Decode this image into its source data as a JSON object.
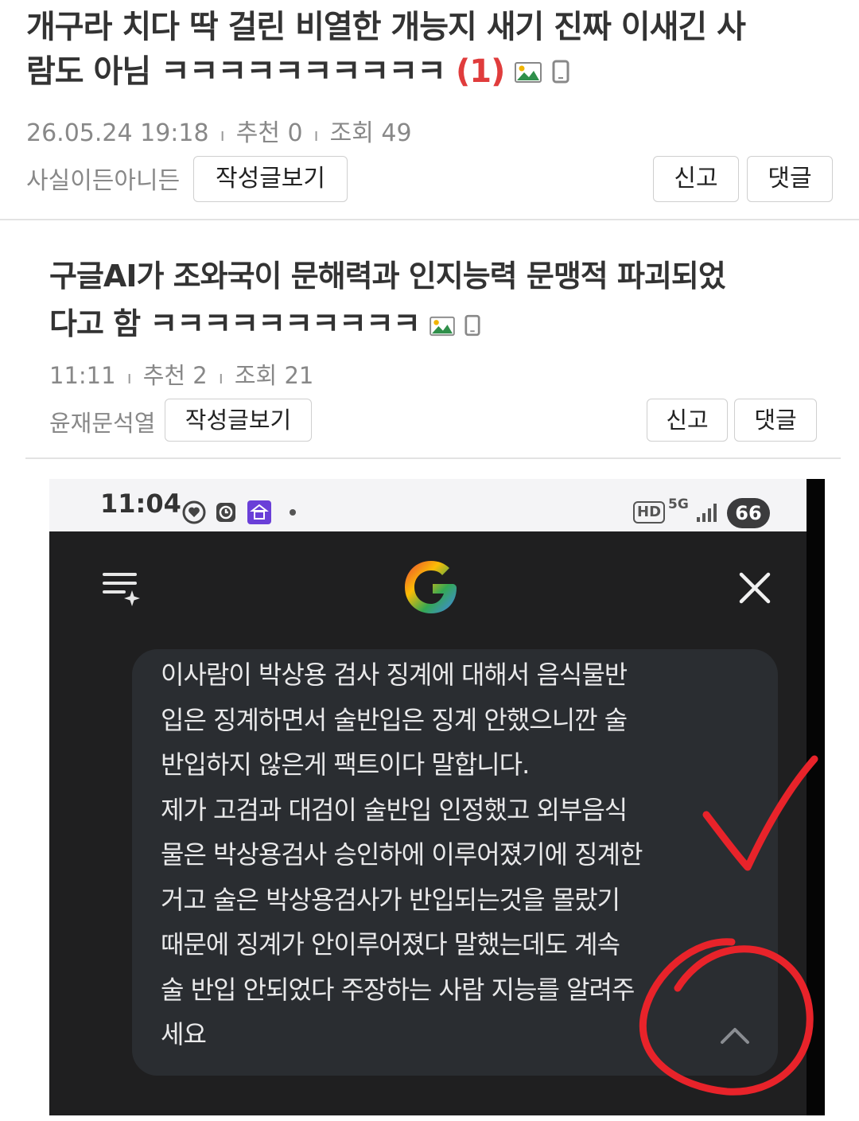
{
  "post1": {
    "title_line1": "개구라 치다 딱 걸린 비열한 개능지 새기 진짜 이새긴 사",
    "title_line2": "람도 아님 ㅋㅋㅋㅋㅋㅋㅋㅋㅋㅋ",
    "comment_count": "(1)",
    "date": "26.05.24  19:18",
    "recommend": "추천 0",
    "views": "조회 49",
    "author": "사실이든아니든",
    "view_posts_label": "작성글보기",
    "report_label": "신고",
    "reply_label": "댓글"
  },
  "post2": {
    "title_line1": "구글AI가 조와국이 문해력과 인지능력 문맹적 파괴되었",
    "title_line2": "다고 함 ㅋㅋㅋㅋㅋㅋㅋㅋㅋㅋ",
    "time": "11:11",
    "recommend": "추천 2",
    "views": "조회 21",
    "author": "윤재문석열",
    "view_posts_label": "작성글보기",
    "report_label": "신고",
    "reply_label": "댓글"
  },
  "screenshot": {
    "status_time": "11:04",
    "hd_label": "HD",
    "network_label": "5G",
    "battery": "66",
    "message": "이사람이 박상용 검사 징계에 대해서 음식물반\n입은 징계하면서 술반입은 징계 안했으니깐 술\n반입하지 않은게 팩트이다 말합니다.\n제가 고검과 대검이 술반입 인정했고 외부음식\n물은 박상용검사 승인하에 이루어졌기에 징계한\n거고 술은 박상용검사가 반입되는것을 몰랐기\n때문에 징계가 안이루어졌다 말했는데도 계속\n술 반입 안되었다 주장하는 사람 지능를 알려주\n세요",
    "icons": [
      "menu-sparkle-icon",
      "google-logo-icon",
      "close-icon",
      "chevron-up-icon"
    ]
  },
  "colors": {
    "comment_count": "#e03c3c",
    "annotation": "#e8232a",
    "meta": "#888888"
  }
}
